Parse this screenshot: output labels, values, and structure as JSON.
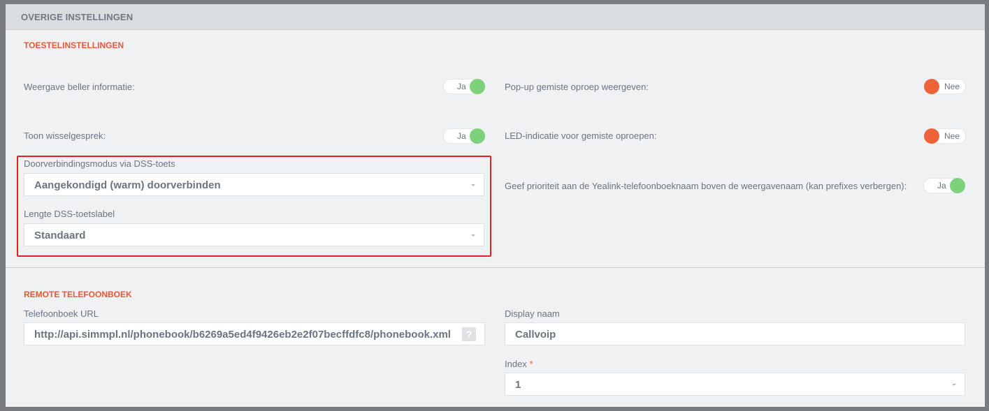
{
  "panel": {
    "title": "OVERIGE INSTELLINGEN"
  },
  "device": {
    "section_title": "TOESTELINSTELLINGEN",
    "caller_info": {
      "label": "Weergave beller informatie:",
      "value": "Ja",
      "state": "on"
    },
    "missed_popup": {
      "label": "Pop-up gemiste oproep weergeven:",
      "value": "Nee",
      "state": "off"
    },
    "toggle_call": {
      "label": "Toon wisselgesprek:",
      "value": "Ja",
      "state": "on"
    },
    "led_missed": {
      "label": "LED-indicatie voor gemiste oproepen:",
      "value": "Nee",
      "state": "off"
    },
    "yealink_priority": {
      "label": "Geef prioriteit aan de Yealink-telefoonboeknaam boven de weergavenaam (kan prefixes verbergen):",
      "value": "Ja",
      "state": "on"
    },
    "dss_transfer": {
      "label": "Doorverbindingsmodus via DSS-toets",
      "value": "Aangekondigd (warm) doorverbinden"
    },
    "dss_label_length": {
      "label": "Lengte DSS-toetslabel",
      "value": "Standaard"
    }
  },
  "remote": {
    "section_title": "REMOTE TELEFOONBOEK",
    "url": {
      "label": "Telefoonboek URL",
      "value": "http://api.simmpl.nl/phonebook/b6269a5ed4f9426eb2e2f07becffdfc8/phonebook.xml",
      "help": "?"
    },
    "display_name": {
      "label": "Display naam",
      "value": "Callvoip"
    },
    "index": {
      "label": "Index",
      "required_mark": "*",
      "value": "1"
    }
  },
  "colors": {
    "accent": "#e8573a",
    "on": "#7cd17a",
    "off": "#ef6339",
    "highlight": "#e31e24"
  }
}
